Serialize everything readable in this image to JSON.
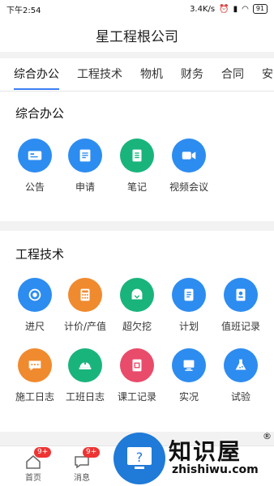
{
  "status": {
    "time": "下午2:54",
    "speed": "3.4K/s",
    "battery": "91"
  },
  "header": {
    "title": "星工程根公司"
  },
  "tabs": [
    {
      "label": "综合办公",
      "active": true
    },
    {
      "label": "工程技术"
    },
    {
      "label": "物机"
    },
    {
      "label": "财务"
    },
    {
      "label": "合同"
    },
    {
      "label": "安"
    }
  ],
  "section1": {
    "title": "综合办公",
    "items": [
      {
        "label": "公告",
        "icon": "notice-card-icon",
        "color": "#2d8cf0"
      },
      {
        "label": "申请",
        "icon": "application-form-icon",
        "color": "#2d8cf0"
      },
      {
        "label": "笔记",
        "icon": "notebook-icon",
        "color": "#19b47c"
      },
      {
        "label": "视频会议",
        "icon": "video-camera-icon",
        "color": "#2d8cf0"
      }
    ]
  },
  "section2": {
    "title": "工程技术",
    "items": [
      {
        "label": "进尺",
        "icon": "progress-circle-icon",
        "color": "#2d8cf0"
      },
      {
        "label": "计价/产值",
        "icon": "calculator-icon",
        "color": "#f08a2e"
      },
      {
        "label": "超欠挖",
        "icon": "excavation-icon",
        "color": "#19b47c"
      },
      {
        "label": "计划",
        "icon": "scroll-plan-icon",
        "color": "#2d8cf0"
      },
      {
        "label": "值班记录",
        "icon": "duty-record-icon",
        "color": "#2d8cf0"
      },
      {
        "label": "施工日志",
        "icon": "chat-log-icon",
        "color": "#f08a2e"
      },
      {
        "label": "工班日志",
        "icon": "helmet-icon",
        "color": "#19b47c"
      },
      {
        "label": "课工记录",
        "icon": "class-record-icon",
        "color": "#e94b6a"
      },
      {
        "label": "实况",
        "icon": "monitor-icon",
        "color": "#2d8cf0"
      },
      {
        "label": "试验",
        "icon": "flask-icon",
        "color": "#2d8cf0"
      }
    ]
  },
  "bottom_nav": [
    {
      "label": "首页",
      "badge": "9+"
    },
    {
      "label": "消息",
      "badge": "9+"
    }
  ],
  "watermark": {
    "text": "知识屋",
    "url": "zhishiwu.com",
    "reg": "®"
  }
}
